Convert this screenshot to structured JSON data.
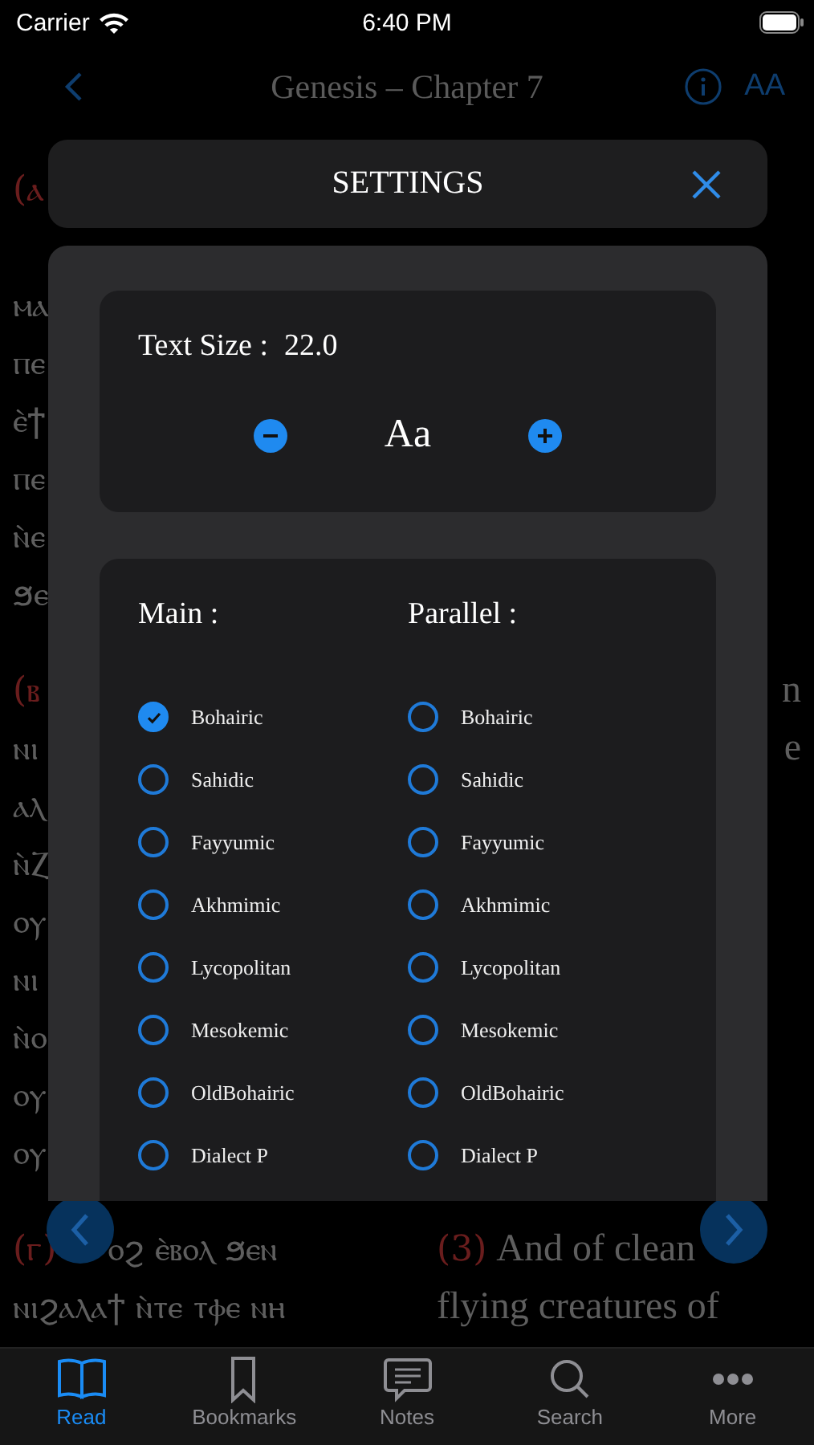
{
  "status_bar": {
    "carrier": "Carrier",
    "time": "6:40 PM"
  },
  "nav": {
    "title": "Genesis – Chapter 7",
    "font_button": "AA"
  },
  "verses": [
    {
      "rows": [
        {
          "left_number": "(ⲁ"
        },
        {},
        {
          "left": "ⲙⲁ"
        },
        {
          "left": "ⲡⲉ"
        },
        {
          "left": "ⲉ̀ϯ"
        },
        {
          "left": "ⲡⲉ"
        },
        {
          "left": "ⲛ̀ⲉ"
        },
        {
          "left": "ϧⲉ"
        }
      ]
    },
    {
      "rows": [
        {
          "left_number": "(ⲃ",
          "right_edge": "n"
        },
        {
          "left": "ⲛⲓ",
          "right_edge": "e"
        },
        {
          "left": "ⲁⲗ"
        },
        {
          "left": "ⲛ̀Ⲍ"
        },
        {
          "left": "ⲟⲩ"
        },
        {
          "left": "ⲛⲓ"
        },
        {
          "left": "ⲛ̀ⲟ"
        },
        {
          "left": "ⲟⲩ"
        },
        {
          "left": "ⲟⲩ"
        }
      ]
    },
    {
      "rows": [
        {
          "left_number": "(ⲅ)",
          "left": "ⲟϩ ⲉ̀ⲃⲟⲗ ϧⲉⲛ",
          "right_number": "(3)",
          "right": "And of clean"
        },
        {
          "left": "ⲛⲓϩⲁⲗⲁϯ ⲛ̀ⲧⲉ ⲧⲫⲉ ⲛⲏ",
          "right": "flying creatures of"
        }
      ]
    }
  ],
  "settings": {
    "title": "SETTINGS",
    "text_size_label": "Text Size :",
    "text_size_value": "22.0",
    "preview": "Aa",
    "main_label": "Main :",
    "parallel_label": "Parallel :",
    "main_options": [
      {
        "label": "Bohairic",
        "selected": true
      },
      {
        "label": "Sahidic",
        "selected": false
      },
      {
        "label": "Fayyumic",
        "selected": false
      },
      {
        "label": "Akhmimic",
        "selected": false
      },
      {
        "label": "Lycopolitan",
        "selected": false
      },
      {
        "label": "Mesokemic",
        "selected": false
      },
      {
        "label": "OldBohairic",
        "selected": false
      },
      {
        "label": "Dialect P",
        "selected": false
      }
    ],
    "parallel_options": [
      {
        "label": "Bohairic",
        "selected": false
      },
      {
        "label": "Sahidic",
        "selected": false
      },
      {
        "label": "Fayyumic",
        "selected": false
      },
      {
        "label": "Akhmimic",
        "selected": false
      },
      {
        "label": "Lycopolitan",
        "selected": false
      },
      {
        "label": "Mesokemic",
        "selected": false
      },
      {
        "label": "OldBohairic",
        "selected": false
      },
      {
        "label": "Dialect P",
        "selected": false
      }
    ]
  },
  "tabs": [
    {
      "kind": "book",
      "label": "Read",
      "selected": true
    },
    {
      "kind": "bookmark",
      "label": "Bookmarks",
      "selected": false
    },
    {
      "kind": "notes",
      "label": "Notes",
      "selected": false
    },
    {
      "kind": "search",
      "label": "Search",
      "selected": false
    },
    {
      "kind": "more",
      "label": "More",
      "selected": false
    }
  ]
}
